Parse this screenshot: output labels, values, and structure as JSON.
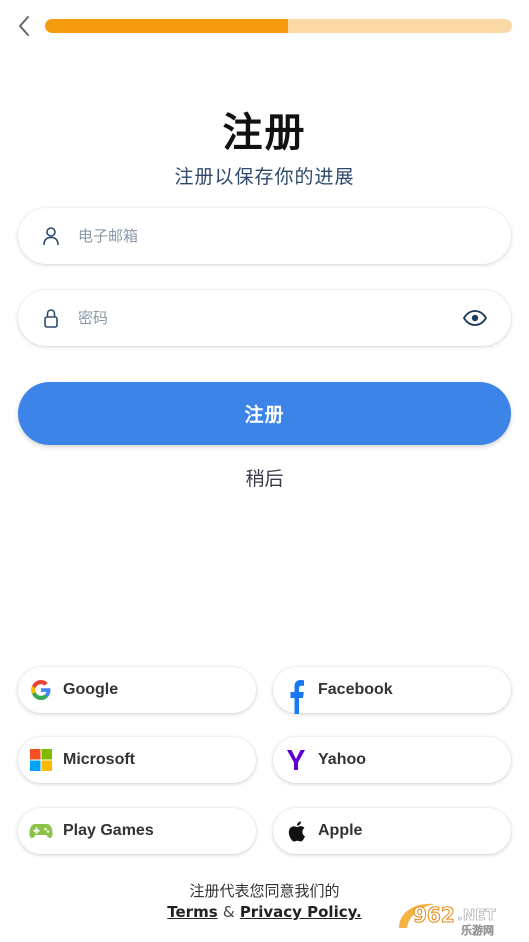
{
  "progress": {
    "fraction": 0.52
  },
  "colors": {
    "accent": "#3d84e8",
    "progress_fill": "#f59a0c",
    "progress_track": "#fbd9a6"
  },
  "header": {
    "title": "注册",
    "subtitle": "注册以保存你的进展"
  },
  "form": {
    "email_placeholder": "电子邮箱",
    "password_placeholder": "密码"
  },
  "actions": {
    "register_label": "注册",
    "later_label": "稍后"
  },
  "social": [
    {
      "id": "google",
      "label": "Google",
      "icon": "google-icon"
    },
    {
      "id": "facebook",
      "label": "Facebook",
      "icon": "facebook-icon"
    },
    {
      "id": "microsoft",
      "label": "Microsoft",
      "icon": "microsoft-icon"
    },
    {
      "id": "yahoo",
      "label": "Yahoo",
      "icon": "yahoo-icon"
    },
    {
      "id": "playgames",
      "label": "Play Games",
      "icon": "gamepad-icon"
    },
    {
      "id": "apple",
      "label": "Apple",
      "icon": "apple-icon"
    }
  ],
  "footer": {
    "agree_text": "注册代表您同意我们的",
    "terms_label": "Terms",
    "and_label": "&",
    "privacy_label": "Privacy Policy."
  },
  "watermark": {
    "text": "962.NET 乐游网"
  }
}
